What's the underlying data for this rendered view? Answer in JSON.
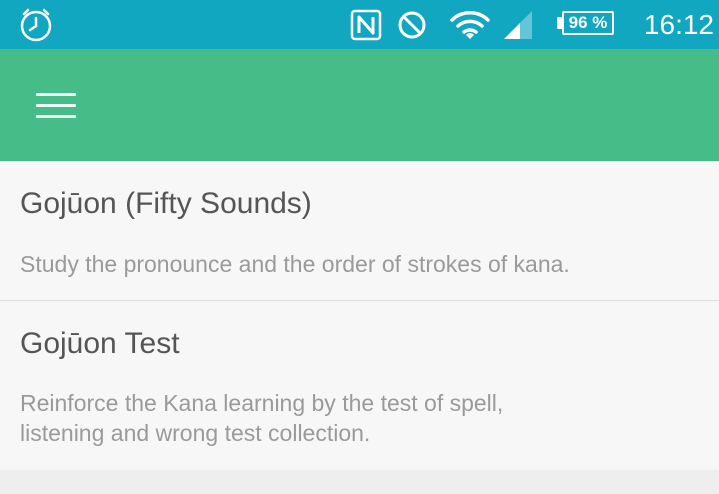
{
  "status_bar": {
    "icons": [
      "alarm-clock-icon",
      "nfc-icon",
      "do-not-disturb-icon",
      "wifi-icon",
      "cell-signal-icon"
    ],
    "battery": "96 %",
    "time": "16:12",
    "color": "#11a7c0"
  },
  "app_bar": {
    "menu_icon": "hamburger-menu-icon",
    "color": "#46bd88"
  },
  "list": {
    "items": [
      {
        "title": "Gojūon (Fifty Sounds)",
        "subtitle": "Study the pronounce and the order of strokes of kana."
      },
      {
        "title": "Gojūon Test",
        "subtitle_line1": "Reinforce the Kana learning by the test of spell,",
        "subtitle_line2": "listening and wrong test collection."
      }
    ]
  }
}
